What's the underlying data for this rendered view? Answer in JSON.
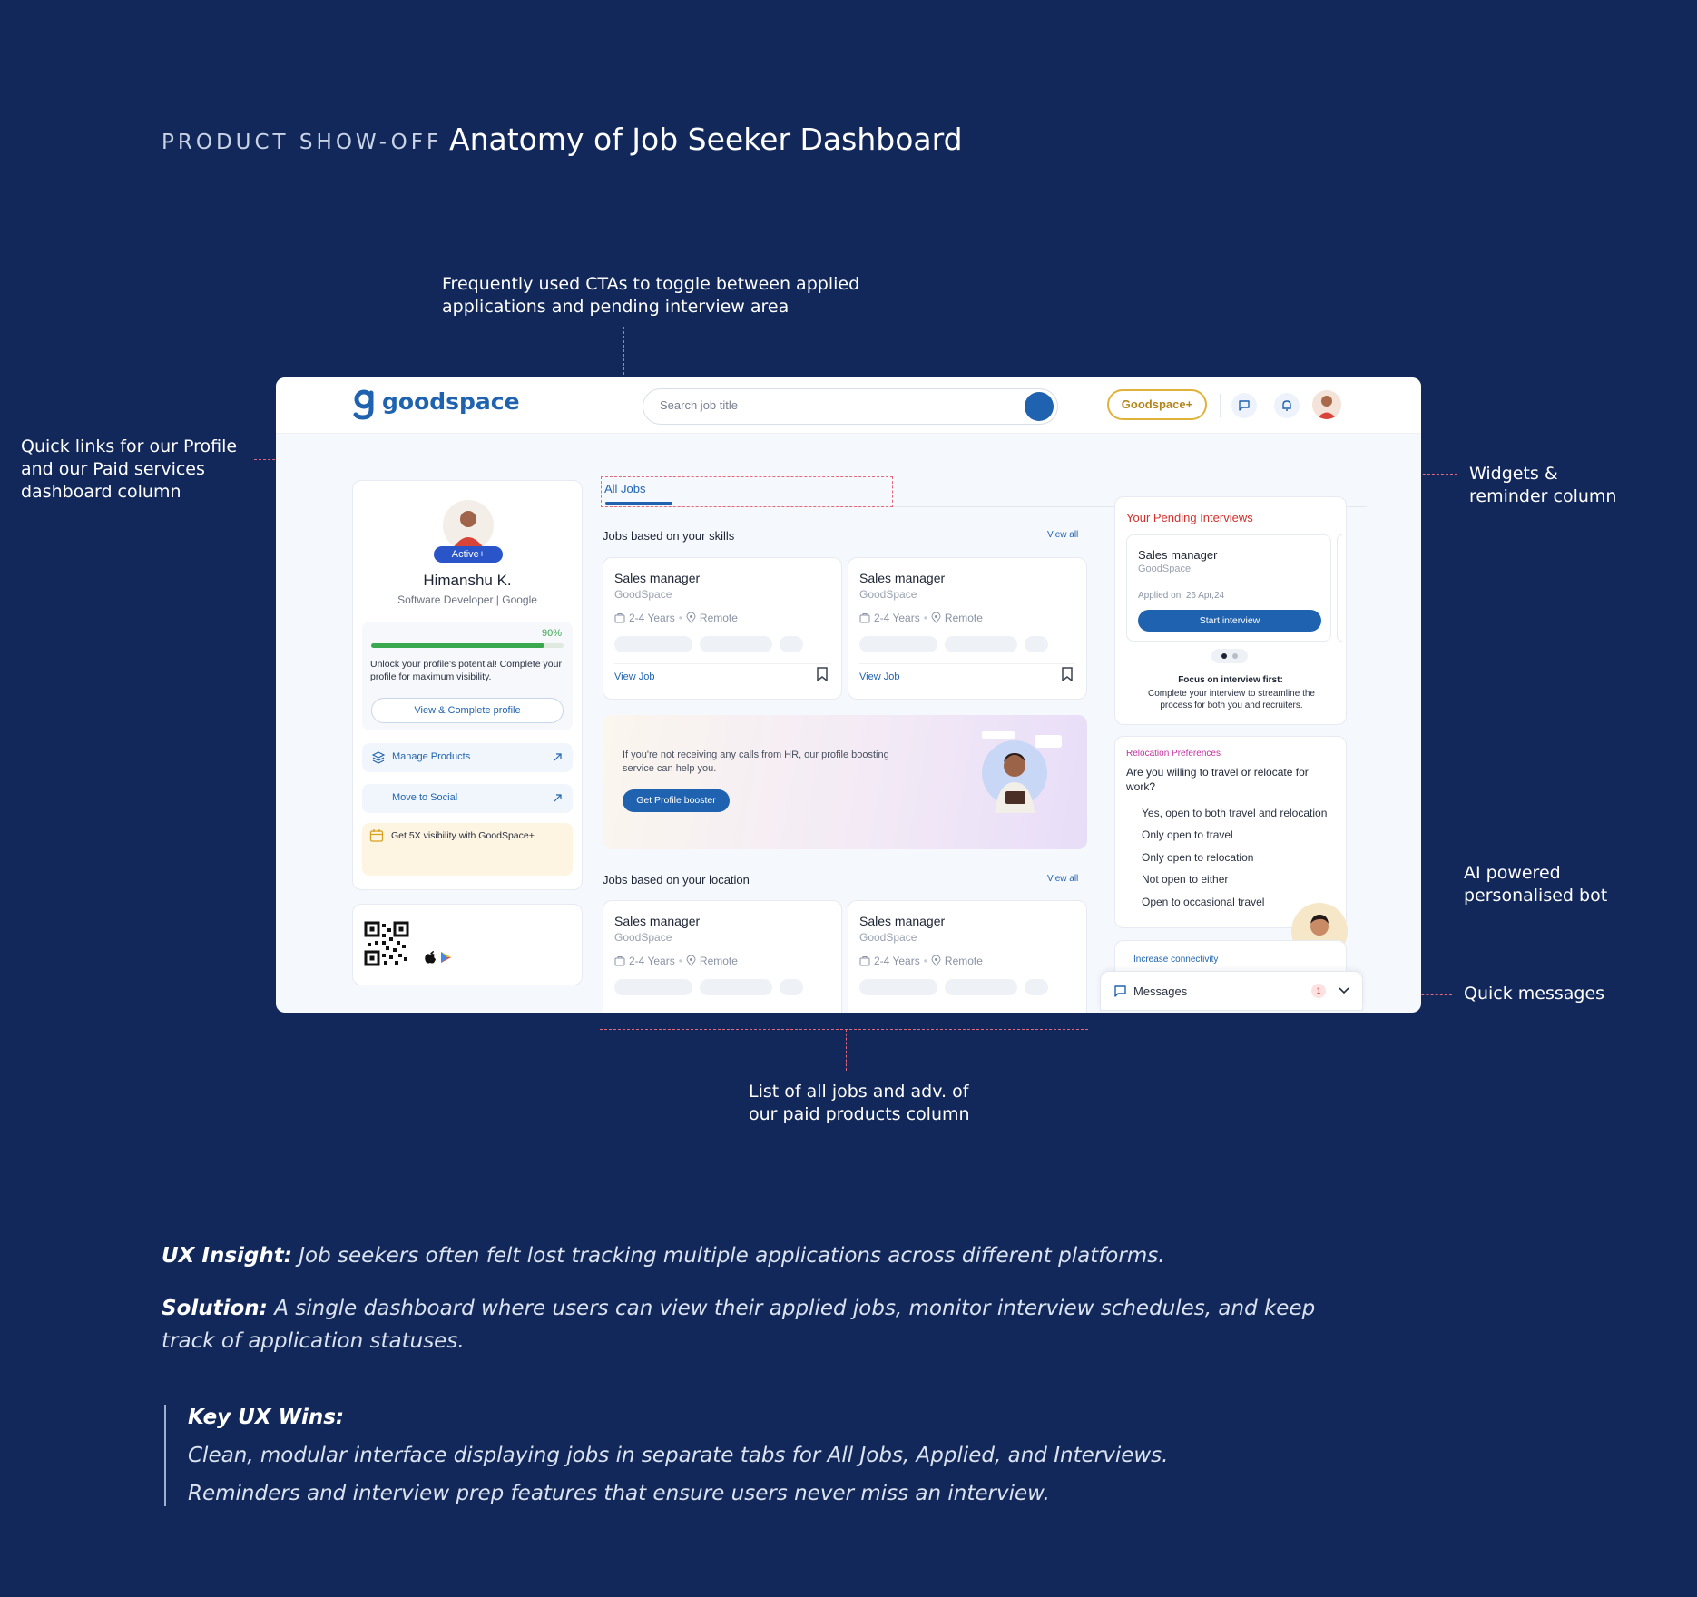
{
  "header": {
    "eyebrow": "PRODUCT SHOW-OFF",
    "title": "Anatomy of Job Seeker Dashboard"
  },
  "annotations": {
    "ctas": [
      "Frequently used CTAs to toggle between applied",
      "applications and pending interview area"
    ],
    "quick_links": [
      "Quick links for our Profile",
      "and our Paid services",
      "dashboard column"
    ],
    "widgets": [
      "Widgets &",
      "reminder column"
    ],
    "ai_bot": [
      "AI powered",
      "personalised bot"
    ],
    "quick_messages": "Quick messages",
    "jobs_list": [
      "List of all jobs and adv. of",
      "our paid products column"
    ]
  },
  "dashboard": {
    "logo": "goodspace",
    "search_placeholder": "Search job title",
    "goodspace_plus": "Goodspace+",
    "profile": {
      "badge": "Active+",
      "name": "Himanshu K.",
      "role": "Software Developer | Google",
      "progress_label": "90%",
      "progress": 0.9,
      "unlock_text": "Unlock your profile's potential! Complete your profile for maximum visibility.",
      "complete_btn": "View & Complete profile",
      "manage_products": "Manage Products",
      "move_to_social": "Move to Social",
      "visibility_promo": "Get 5X visibility with GoodSpace+"
    },
    "tabs": {
      "all_jobs": "All Jobs"
    },
    "skills_section": {
      "title": "Jobs based on your skills",
      "view_all": "View all"
    },
    "location_section": {
      "title": "Jobs based on your location",
      "view_all": "View all"
    },
    "job": {
      "title": "Sales manager",
      "company": "GoodSpace",
      "experience": "2-4 Years",
      "location": "Remote",
      "view_job": "View Job"
    },
    "booster": {
      "text": "If you're not receiving any calls from HR, our profile boosting service can help you.",
      "button": "Get Profile booster"
    },
    "pending": {
      "title": "Your Pending Interviews",
      "job_title": "Sales manager",
      "company": "GoodSpace",
      "applied_on": "Applied on: 26 Apr,24",
      "start_btn": "Start interview",
      "focus_title": "Focus on interview first:",
      "focus_text": "Complete your interview to streamline the process for both you and recruiters."
    },
    "relocation": {
      "label": "Relocation Preferences",
      "question": "Are you willing to travel or relocate for work?",
      "options": [
        "Yes, open to both travel and relocation",
        "Only open to travel",
        "Only open to relocation",
        "Not open to either",
        "Open to occasional travel"
      ]
    },
    "increase_connectivity": "Increase connectivity",
    "messages": {
      "label": "Messages",
      "count": "1"
    }
  },
  "insights": {
    "ux_label": "UX Insight:",
    "ux_text": " Job seekers often felt lost tracking multiple applications across different platforms.",
    "solution_label": "Solution:",
    "solution_text": " A single dashboard where users can view their applied jobs, monitor interview schedules, and keep track of application statuses.",
    "wins_title": "Key UX Wins:",
    "wins": [
      "Clean, modular interface displaying jobs in separate tabs for All Jobs, Applied, and Interviews.",
      "Reminders and interview prep features that ensure users never miss an interview."
    ]
  },
  "colors": {
    "background": "#12285a",
    "brand_blue": "#1f63b0",
    "annotation_line": "#e7677a",
    "pending_red": "#d0312d",
    "relocation_pink": "#c2319e",
    "progress_green": "#3aa84f"
  }
}
